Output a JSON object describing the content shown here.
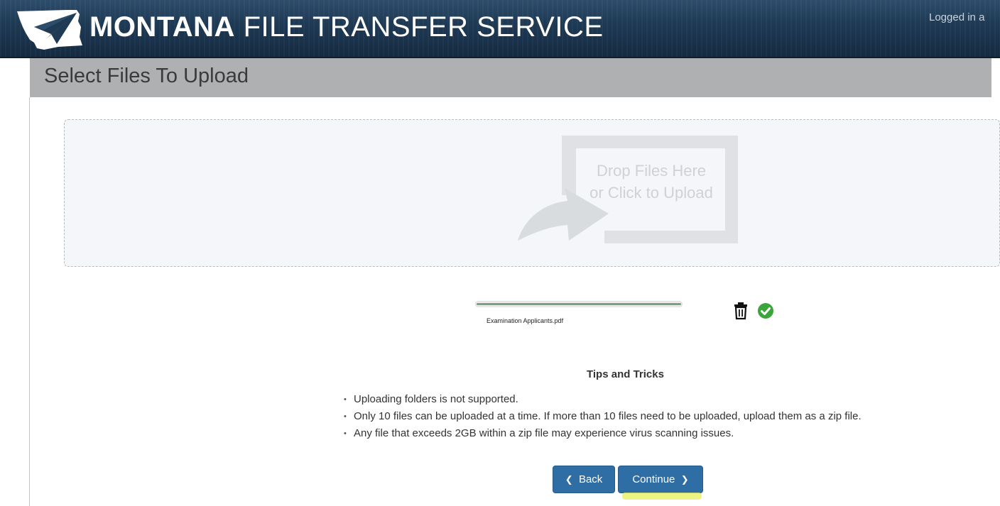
{
  "header": {
    "brand_bold": "MONTANA",
    "brand_light": "FILE TRANSFER SERVICE",
    "login_text": "Logged in a"
  },
  "page": {
    "title": "Select Files To Upload"
  },
  "dropzone": {
    "line1": "Drop Files Here",
    "line2": "or Click to Upload"
  },
  "file": {
    "name": "Examination Applicants.pdf",
    "progress": 1.0,
    "status": "complete"
  },
  "tips": {
    "title": "Tips and Tricks",
    "items": [
      "Uploading folders is not supported.",
      "Only 10 files can be uploaded at a time. If more than 10 files need to be uploaded, upload them as a zip file.",
      "Any file that exceeds 2GB within a zip file may experience virus scanning issues."
    ]
  },
  "buttons": {
    "back_label": "Back",
    "continue_label": "Continue"
  },
  "colors": {
    "header_bg": "#1f3a55",
    "button_blue": "#2f6ea5",
    "success_green": "#3aa53a",
    "highlight_yellow": "#e8f05a"
  },
  "icons": {
    "logo": "montana-state-paper-plane-logo",
    "trash": "trash-icon",
    "check": "check-circle-icon",
    "back": "chevron-left-icon",
    "continue": "chevron-right-icon"
  }
}
